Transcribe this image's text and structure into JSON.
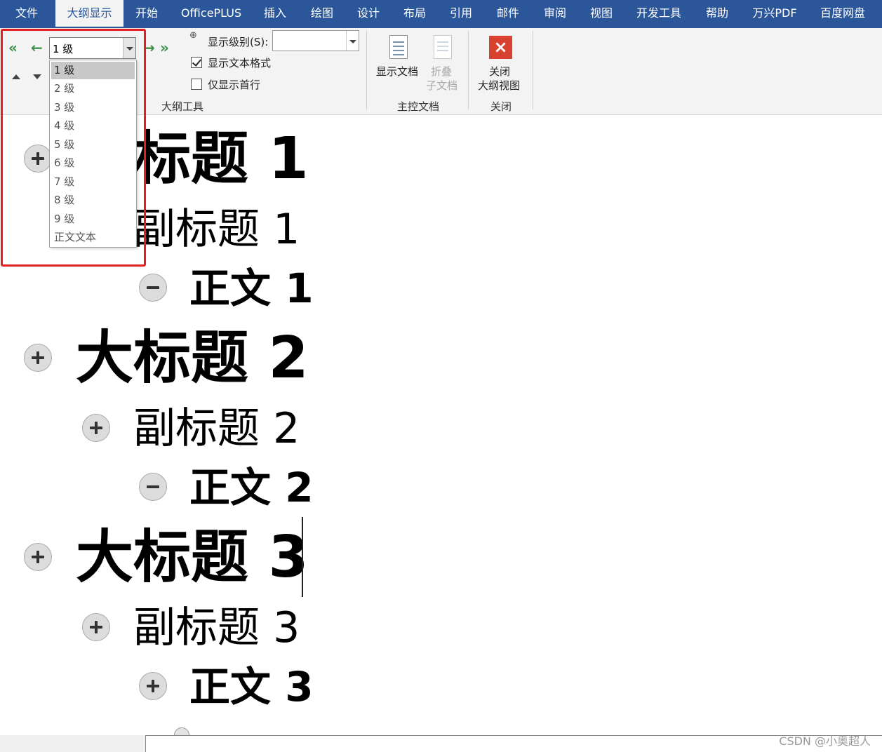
{
  "tabs": [
    {
      "label": "文件",
      "active": false
    },
    {
      "label": "大纲显示",
      "active": true
    },
    {
      "label": "开始",
      "active": false
    },
    {
      "label": "OfficePLUS",
      "active": false
    },
    {
      "label": "插入",
      "active": false
    },
    {
      "label": "绘图",
      "active": false
    },
    {
      "label": "设计",
      "active": false
    },
    {
      "label": "布局",
      "active": false
    },
    {
      "label": "引用",
      "active": false
    },
    {
      "label": "邮件",
      "active": false
    },
    {
      "label": "审阅",
      "active": false
    },
    {
      "label": "视图",
      "active": false
    },
    {
      "label": "开发工具",
      "active": false
    },
    {
      "label": "帮助",
      "active": false
    },
    {
      "label": "万兴PDF",
      "active": false
    },
    {
      "label": "百度网盘",
      "active": false
    }
  ],
  "outline_tools": {
    "level_value": "1 级",
    "show_level_label": "显示级别(S):",
    "show_level_value": "",
    "show_format_label": "显示文本格式",
    "show_format_checked": true,
    "first_line_label": "仅显示首行",
    "first_line_checked": false,
    "group_label": "大纲工具",
    "icons": {
      "promote_to_heading": "double-left-arrow-icon",
      "promote": "left-arrow-icon",
      "demote": "right-arrow-icon",
      "demote_to_body": "double-right-arrow-icon",
      "move_up": "triangle-up-icon",
      "move_down": "triangle-down-icon"
    }
  },
  "master_doc": {
    "show_doc_label": "显示文档",
    "collapse_sub_label_1": "折叠",
    "collapse_sub_label_2": "子文档",
    "group_label": "主控文档"
  },
  "close": {
    "button_label_1": "关闭",
    "button_label_2": "大纲视图",
    "group_label": "关闭",
    "icon": "×"
  },
  "dropdown_items": [
    "1 级",
    "2 级",
    "3 级",
    "4 级",
    "5 级",
    "6 级",
    "7 级",
    "8 级",
    "9 级",
    "正文文本"
  ],
  "document": {
    "h1_1": "大标题 1",
    "h2_1": "副标题 1",
    "body_1": "正文 1",
    "h1_2": "大标题 2",
    "h2_2": "副标题 2",
    "body_2": "正文 2",
    "h1_3": "大标题 3",
    "h2_3": "副标题 3",
    "body_3": "正文 3"
  },
  "watermark": "CSDN @小奥超人",
  "colors": {
    "accent": "#2b579a",
    "highlight": "#e02020",
    "close": "#d8412f"
  }
}
